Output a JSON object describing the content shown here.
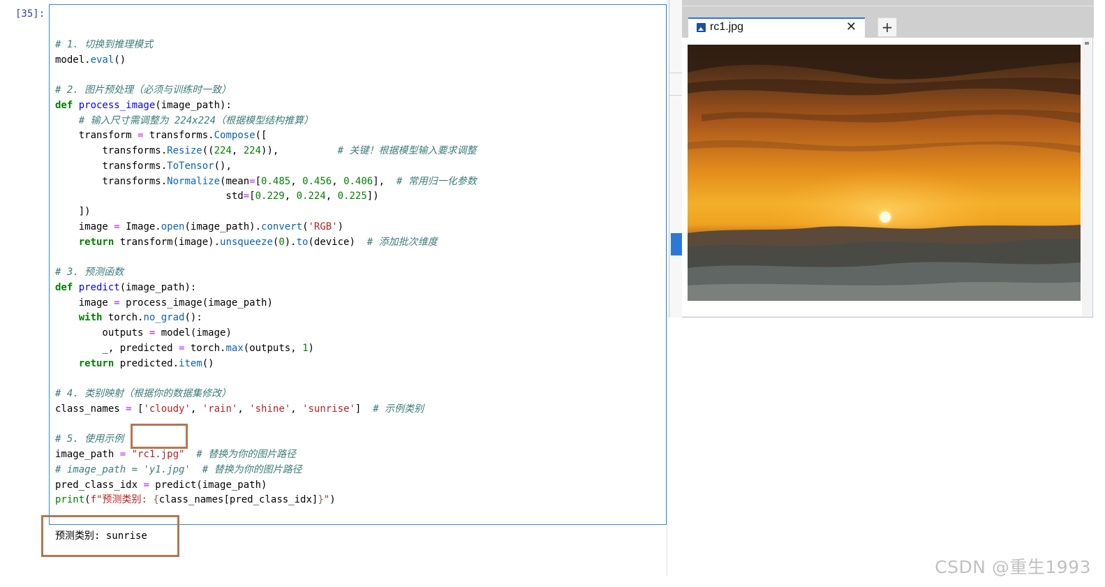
{
  "cell": {
    "prompt": "[35]:",
    "lines": [
      [],
      [
        {
          "text": "# 1. 切换到推理模式",
          "cls": "t-c"
        }
      ],
      [
        {
          "text": "model.",
          "cls": "t-x"
        },
        {
          "text": "eval",
          "cls": "t-a"
        },
        {
          "text": "()",
          "cls": "t-x"
        }
      ],
      [],
      [
        {
          "text": "# 2. 图片预处理（必须与训练时一致）",
          "cls": "t-c"
        }
      ],
      [
        {
          "text": "def ",
          "cls": "t-k"
        },
        {
          "text": "process_image",
          "cls": "t-f"
        },
        {
          "text": "(image_path):",
          "cls": "t-x"
        }
      ],
      [
        {
          "text": "    ",
          "cls": "t-x"
        },
        {
          "text": "# 输入尺寸需调整为 224x224（根据模型结构推算）",
          "cls": "t-c"
        }
      ],
      [
        {
          "text": "    transform ",
          "cls": "t-x"
        },
        {
          "text": "=",
          "cls": "t-o"
        },
        {
          "text": " transforms.",
          "cls": "t-x"
        },
        {
          "text": "Compose",
          "cls": "t-a"
        },
        {
          "text": "([",
          "cls": "t-x"
        }
      ],
      [
        {
          "text": "        transforms.",
          "cls": "t-x"
        },
        {
          "text": "Resize",
          "cls": "t-a"
        },
        {
          "text": "((",
          "cls": "t-x"
        },
        {
          "text": "224",
          "cls": "t-n"
        },
        {
          "text": ", ",
          "cls": "t-x"
        },
        {
          "text": "224",
          "cls": "t-n"
        },
        {
          "text": ")),          ",
          "cls": "t-x"
        },
        {
          "text": "# 关键！根据模型输入要求调整",
          "cls": "t-c"
        }
      ],
      [
        {
          "text": "        transforms.",
          "cls": "t-x"
        },
        {
          "text": "ToTensor",
          "cls": "t-a"
        },
        {
          "text": "(),",
          "cls": "t-x"
        }
      ],
      [
        {
          "text": "        transforms.",
          "cls": "t-x"
        },
        {
          "text": "Normalize",
          "cls": "t-a"
        },
        {
          "text": "(mean",
          "cls": "t-x"
        },
        {
          "text": "=",
          "cls": "t-o"
        },
        {
          "text": "[",
          "cls": "t-x"
        },
        {
          "text": "0.485",
          "cls": "t-n"
        },
        {
          "text": ", ",
          "cls": "t-x"
        },
        {
          "text": "0.456",
          "cls": "t-n"
        },
        {
          "text": ", ",
          "cls": "t-x"
        },
        {
          "text": "0.406",
          "cls": "t-n"
        },
        {
          "text": "],  ",
          "cls": "t-x"
        },
        {
          "text": "# 常用归一化参数",
          "cls": "t-c"
        }
      ],
      [
        {
          "text": "                             std",
          "cls": "t-x"
        },
        {
          "text": "=",
          "cls": "t-o"
        },
        {
          "text": "[",
          "cls": "t-x"
        },
        {
          "text": "0.229",
          "cls": "t-n"
        },
        {
          "text": ", ",
          "cls": "t-x"
        },
        {
          "text": "0.224",
          "cls": "t-n"
        },
        {
          "text": ", ",
          "cls": "t-x"
        },
        {
          "text": "0.225",
          "cls": "t-n"
        },
        {
          "text": "])",
          "cls": "t-x"
        }
      ],
      [
        {
          "text": "    ])",
          "cls": "t-x"
        }
      ],
      [
        {
          "text": "    image ",
          "cls": "t-x"
        },
        {
          "text": "=",
          "cls": "t-o"
        },
        {
          "text": " Image.",
          "cls": "t-x"
        },
        {
          "text": "open",
          "cls": "t-a"
        },
        {
          "text": "(image_path).",
          "cls": "t-x"
        },
        {
          "text": "convert",
          "cls": "t-a"
        },
        {
          "text": "(",
          "cls": "t-x"
        },
        {
          "text": "'RGB'",
          "cls": "t-s"
        },
        {
          "text": ")",
          "cls": "t-x"
        }
      ],
      [
        {
          "text": "    ",
          "cls": "t-x"
        },
        {
          "text": "return",
          "cls": "t-k"
        },
        {
          "text": " transform(image).",
          "cls": "t-x"
        },
        {
          "text": "unsqueeze",
          "cls": "t-a"
        },
        {
          "text": "(",
          "cls": "t-x"
        },
        {
          "text": "0",
          "cls": "t-n"
        },
        {
          "text": ").",
          "cls": "t-x"
        },
        {
          "text": "to",
          "cls": "t-a"
        },
        {
          "text": "(device)  ",
          "cls": "t-x"
        },
        {
          "text": "# 添加批次维度",
          "cls": "t-c"
        }
      ],
      [],
      [
        {
          "text": "# 3. 预测函数",
          "cls": "t-c"
        }
      ],
      [
        {
          "text": "def ",
          "cls": "t-k"
        },
        {
          "text": "predict",
          "cls": "t-f"
        },
        {
          "text": "(image_path):",
          "cls": "t-x"
        }
      ],
      [
        {
          "text": "    image ",
          "cls": "t-x"
        },
        {
          "text": "=",
          "cls": "t-o"
        },
        {
          "text": " process_image(image_path)",
          "cls": "t-x"
        }
      ],
      [
        {
          "text": "    ",
          "cls": "t-x"
        },
        {
          "text": "with",
          "cls": "t-k"
        },
        {
          "text": " torch.",
          "cls": "t-x"
        },
        {
          "text": "no_grad",
          "cls": "t-a"
        },
        {
          "text": "():",
          "cls": "t-x"
        }
      ],
      [
        {
          "text": "        outputs ",
          "cls": "t-x"
        },
        {
          "text": "=",
          "cls": "t-o"
        },
        {
          "text": " model(image)",
          "cls": "t-x"
        }
      ],
      [
        {
          "text": "        _, predicted ",
          "cls": "t-x"
        },
        {
          "text": "=",
          "cls": "t-o"
        },
        {
          "text": " torch.",
          "cls": "t-x"
        },
        {
          "text": "max",
          "cls": "t-a"
        },
        {
          "text": "(outputs, ",
          "cls": "t-x"
        },
        {
          "text": "1",
          "cls": "t-n"
        },
        {
          "text": ")",
          "cls": "t-x"
        }
      ],
      [
        {
          "text": "    ",
          "cls": "t-x"
        },
        {
          "text": "return",
          "cls": "t-k"
        },
        {
          "text": " predicted.",
          "cls": "t-x"
        },
        {
          "text": "item",
          "cls": "t-a"
        },
        {
          "text": "()",
          "cls": "t-x"
        }
      ],
      [],
      [
        {
          "text": "# 4. 类别映射（根据你的数据集修改）",
          "cls": "t-c"
        }
      ],
      [
        {
          "text": "class_names ",
          "cls": "t-x"
        },
        {
          "text": "=",
          "cls": "t-o"
        },
        {
          "text": " [",
          "cls": "t-x"
        },
        {
          "text": "'cloudy'",
          "cls": "t-s"
        },
        {
          "text": ", ",
          "cls": "t-x"
        },
        {
          "text": "'rain'",
          "cls": "t-s"
        },
        {
          "text": ", ",
          "cls": "t-x"
        },
        {
          "text": "'shine'",
          "cls": "t-s"
        },
        {
          "text": ", ",
          "cls": "t-x"
        },
        {
          "text": "'sunrise'",
          "cls": "t-s"
        },
        {
          "text": "]  ",
          "cls": "t-x"
        },
        {
          "text": "# 示例类别",
          "cls": "t-c"
        }
      ],
      [],
      [
        {
          "text": "# 5. 使用示例",
          "cls": "t-c"
        }
      ],
      [
        {
          "text": "image_path ",
          "cls": "t-x"
        },
        {
          "text": "=",
          "cls": "t-o"
        },
        {
          "text": " ",
          "cls": "t-x"
        },
        {
          "text": "\"rc1.jpg\"",
          "cls": "t-s"
        },
        {
          "text": "  ",
          "cls": "t-x"
        },
        {
          "text": "# 替换为你的图片路径",
          "cls": "t-c"
        }
      ],
      [
        {
          "text": "# image_path = 'y1.jpg'  # 替换为你的图片路径",
          "cls": "t-c"
        }
      ],
      [
        {
          "text": "pred_class_idx ",
          "cls": "t-x"
        },
        {
          "text": "=",
          "cls": "t-o"
        },
        {
          "text": " predict(image_path)",
          "cls": "t-x"
        }
      ],
      [
        {
          "text": "print",
          "cls": "t-b"
        },
        {
          "text": "(",
          "cls": "t-x"
        },
        {
          "text": "f\"预测类别: ",
          "cls": "t-s"
        },
        {
          "text": "{",
          "cls": "t-e"
        },
        {
          "text": "class_names[pred_class_idx]",
          "cls": "t-x"
        },
        {
          "text": "}",
          "cls": "t-e"
        },
        {
          "text": "\"",
          "cls": "t-s"
        },
        {
          "text": ")",
          "cls": "t-x"
        }
      ]
    ]
  },
  "output": {
    "text": "预测类别: sunrise"
  },
  "viewer": {
    "tab_title": "rc1.jpg",
    "close_glyph": "✕",
    "add_glyph": "+"
  },
  "watermark": "CSDN @重生1993"
}
